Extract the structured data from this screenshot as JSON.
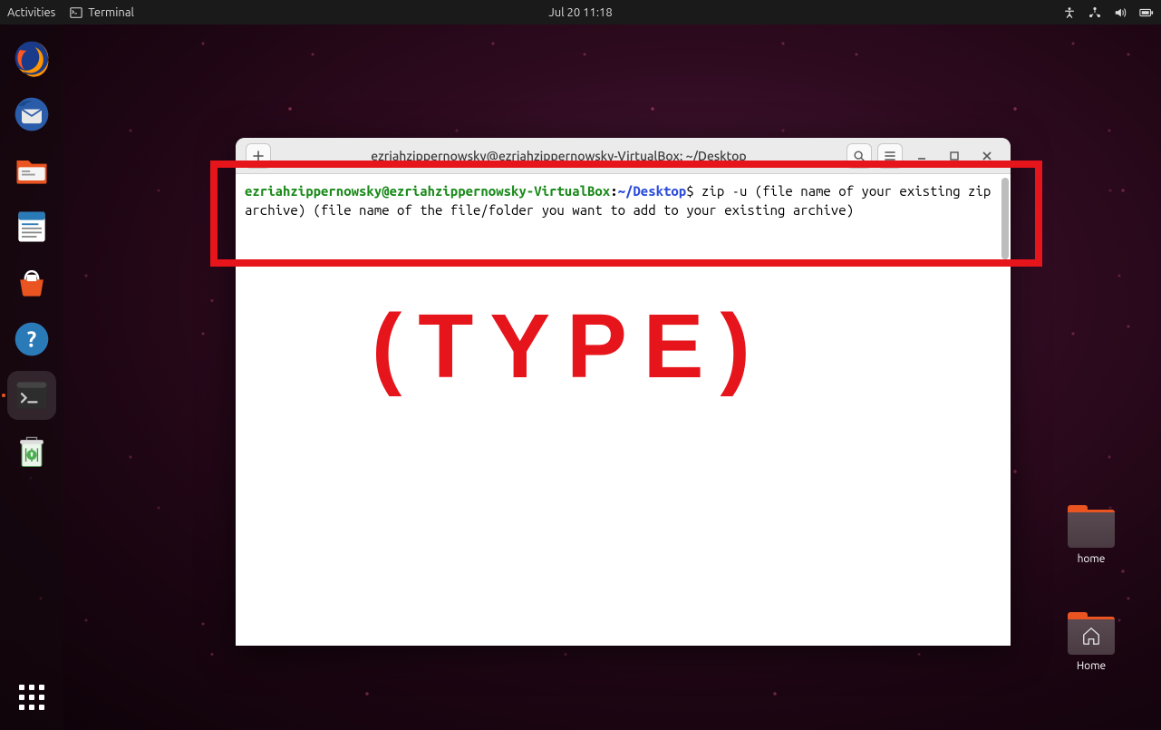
{
  "topbar": {
    "activities": "Activities",
    "app_name": "Terminal",
    "datetime": "Jul 20  11:18"
  },
  "dock": {
    "items": [
      {
        "name": "firefox"
      },
      {
        "name": "thunderbird"
      },
      {
        "name": "files"
      },
      {
        "name": "libreoffice-writer"
      },
      {
        "name": "ubuntu-software"
      },
      {
        "name": "help"
      },
      {
        "name": "terminal",
        "active": true
      },
      {
        "name": "trash"
      }
    ]
  },
  "desktop": {
    "icons": [
      {
        "label": "home",
        "kind": "folder"
      },
      {
        "label": "Home",
        "kind": "user-home"
      }
    ]
  },
  "window": {
    "title": "ezriahzippernowsky@ezriahzippernowsky-VirtualBox: ~/Desktop",
    "prompt_user": "ezriahzippernowsky@ezriahzippernowsky-VirtualBox",
    "prompt_colon": ":",
    "prompt_path": "~/Desktop",
    "prompt_dollar": "$",
    "command": " zip -u (file name of your existing zip archive) (file name of the file/folder you want to add to your existing archive)"
  },
  "annotation": {
    "text": "(TYPE)"
  }
}
